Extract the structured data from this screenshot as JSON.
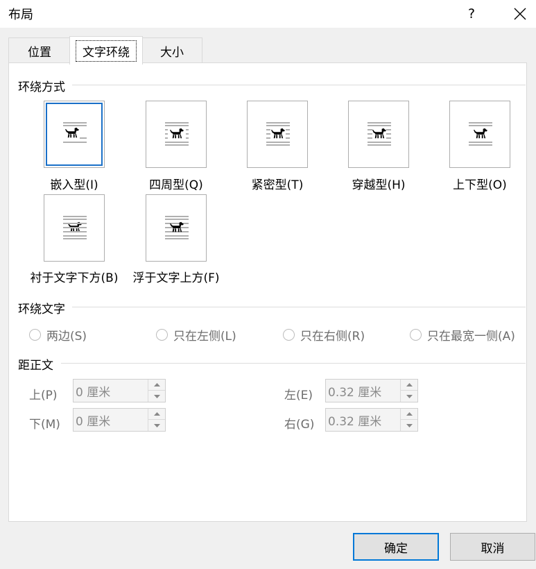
{
  "window": {
    "title": "布局",
    "help_label": "?"
  },
  "tabs": [
    {
      "label": "位置",
      "active": false
    },
    {
      "label": "文字环绕",
      "active": true
    },
    {
      "label": "大小",
      "active": false
    }
  ],
  "wrap_style": {
    "section_title": "环绕方式",
    "options": [
      {
        "label": "嵌入型(I)",
        "selected": true
      },
      {
        "label": "四周型(Q)",
        "selected": false
      },
      {
        "label": "紧密型(T)",
        "selected": false
      },
      {
        "label": "穿越型(H)",
        "selected": false
      },
      {
        "label": "上下型(O)",
        "selected": false
      },
      {
        "label": "衬于文字下方(B)",
        "selected": false
      },
      {
        "label": "浮于文字上方(F)",
        "selected": false
      }
    ]
  },
  "wrap_text": {
    "section_title": "环绕文字",
    "options": [
      "两边(S)",
      "只在左侧(L)",
      "只在右侧(R)",
      "只在最宽一侧(A)"
    ]
  },
  "distance": {
    "section_title": "距正文",
    "top": {
      "label": "上(P)",
      "value": "0 厘米"
    },
    "bottom": {
      "label": "下(M)",
      "value": "0 厘米"
    },
    "left": {
      "label": "左(E)",
      "value": "0.32 厘米"
    },
    "right": {
      "label": "右(G)",
      "value": "0.32 厘米"
    }
  },
  "buttons": {
    "ok": "确定",
    "cancel": "取消"
  },
  "colors": {
    "accent": "#0078d7",
    "selection": "#1a70c8"
  }
}
